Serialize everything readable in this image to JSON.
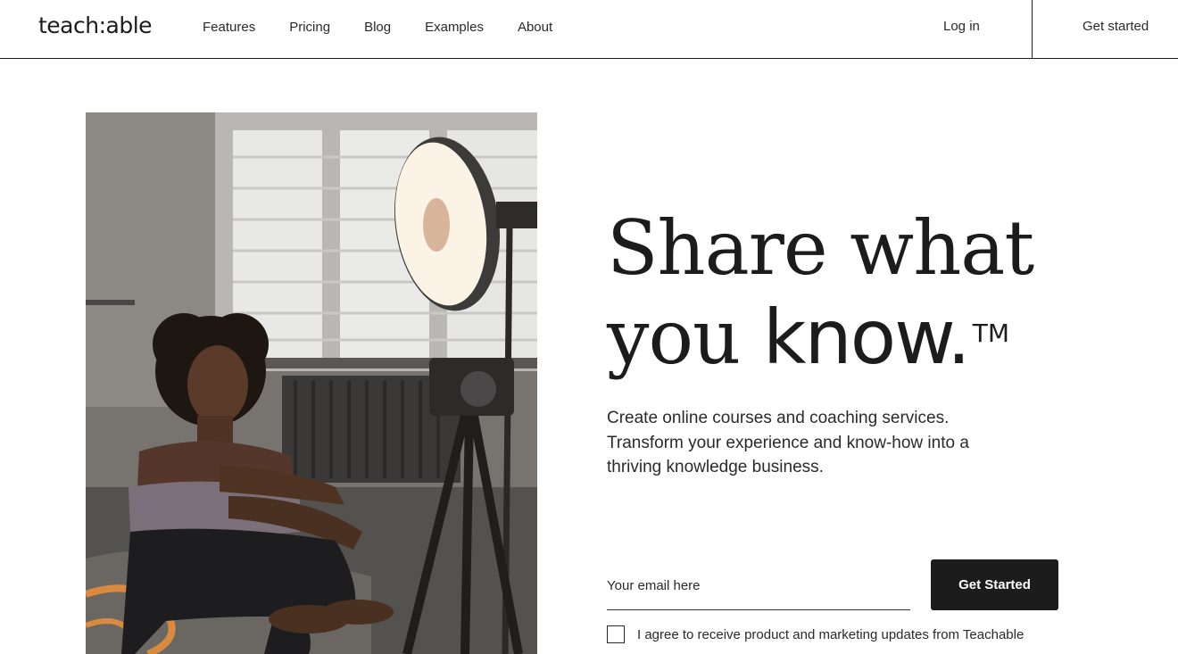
{
  "header": {
    "logo": "teach:able",
    "nav": [
      {
        "label": "Features"
      },
      {
        "label": "Pricing"
      },
      {
        "label": "Blog"
      },
      {
        "label": "Examples"
      },
      {
        "label": "About"
      }
    ],
    "login_label": "Log in",
    "get_started_label": "Get started"
  },
  "hero": {
    "headline_line1": "Share what",
    "headline_line2_serif": "you ",
    "headline_line2_sans": "know.",
    "trademark": "TM",
    "subtext": "Create online courses and coaching services. Transform your experience and know-how into a thriving knowledge business.",
    "image": "woman-seated-with-camera-and-ring-light"
  },
  "form": {
    "email_placeholder": "Your email here",
    "email_value": "",
    "submit_label": "Get Started",
    "consent_label": "I agree to receive product and marketing updates from Teachable",
    "consent_checked": false
  },
  "colors": {
    "text": "#1c1c1c",
    "button_bg": "#1c1c1c",
    "button_text": "#ffffff",
    "background": "#ffffff"
  }
}
